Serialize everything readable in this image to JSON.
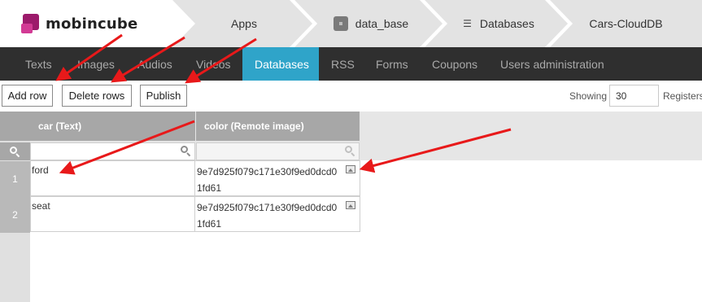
{
  "app": {
    "logo_text": "mobincube"
  },
  "breadcrumb": {
    "items": [
      {
        "label": "Apps",
        "icon": ""
      },
      {
        "label": "data_base",
        "icon": "app-icon"
      },
      {
        "label": "Databases",
        "icon": "database-icon"
      },
      {
        "label": "Cars-CloudDB",
        "icon": ""
      }
    ]
  },
  "nav": {
    "items": [
      "Texts",
      "Images",
      "Audios",
      "Videos",
      "Databases",
      "RSS",
      "Forms",
      "Coupons",
      "Users administration"
    ],
    "active": "Databases"
  },
  "toolbar": {
    "add_row": "Add row",
    "delete_rows": "Delete rows",
    "publish": "Publish",
    "showing_label": "Showing",
    "registers_value": "30",
    "registers_label": "Registers"
  },
  "table": {
    "columns": [
      "car (Text)",
      "color (Remote image)"
    ],
    "rows": [
      {
        "num": "1",
        "car": "ford",
        "color": "9e7d925f079c171e30f9ed0dcd01fd61"
      },
      {
        "num": "2",
        "car": "seat",
        "color": "9e7d925f079c171e30f9ed0dcd01fd61"
      }
    ]
  },
  "colors": {
    "nav_bg": "#2f2f2f",
    "nav_active": "#2fa4c9",
    "header_cells": "#a7a7a7",
    "breadcrumb_bg": "#e3e3e3",
    "annotation_arrow": "#e8191a",
    "logo_primary": "#9c1a6b"
  }
}
